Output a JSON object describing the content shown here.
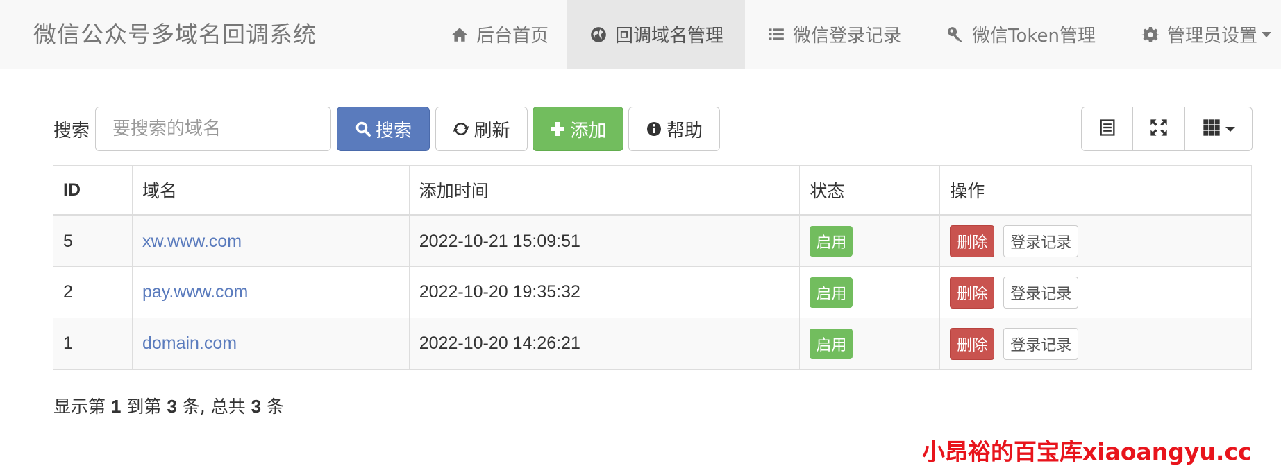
{
  "navbar": {
    "brand": "微信公众号多域名回调系统",
    "items": [
      {
        "label": "后台首页",
        "icon": "home-icon",
        "active": false
      },
      {
        "label": "回调域名管理",
        "icon": "globe-icon",
        "active": true
      },
      {
        "label": "微信登录记录",
        "icon": "list-icon",
        "active": false
      },
      {
        "label": "微信Token管理",
        "icon": "key-icon",
        "active": false
      },
      {
        "label": "管理员设置",
        "icon": "gear-icon",
        "active": false
      }
    ]
  },
  "toolbar": {
    "search_label": "搜索",
    "search_placeholder": "要搜索的域名",
    "search_value": "",
    "search_button": "搜索",
    "refresh_button": "刷新",
    "add_button": "添加",
    "help_button": "帮助",
    "view_icons": [
      "list-view-icon",
      "fullscreen-icon",
      "columns-grid-icon"
    ]
  },
  "table": {
    "headers": [
      "ID",
      "域名",
      "添加时间",
      "状态",
      "操作"
    ],
    "rows": [
      {
        "id": "5",
        "domain": "xw.www.com",
        "time": "2022-10-21 15:09:51",
        "status": "启用",
        "delete": "删除",
        "log": "登录记录"
      },
      {
        "id": "2",
        "domain": "pay.www.com",
        "time": "2022-10-20 19:35:32",
        "status": "启用",
        "delete": "删除",
        "log": "登录记录"
      },
      {
        "id": "1",
        "domain": "domain.com",
        "time": "2022-10-20 14:26:21",
        "status": "启用",
        "delete": "删除",
        "log": "登录记录"
      }
    ]
  },
  "pagination": {
    "prefix": "显示第 ",
    "from": "1",
    "mid1": " 到第 ",
    "to": "3",
    "mid2": " 条, 总共 ",
    "total": "3",
    "suffix": " 条"
  },
  "watermark": "小昂裕的百宝库xiaoangyu.cc",
  "colors": {
    "primary": "#5a7bbd",
    "success": "#72bd5e",
    "danger": "#c9534f",
    "watermark": "#e8141c"
  }
}
